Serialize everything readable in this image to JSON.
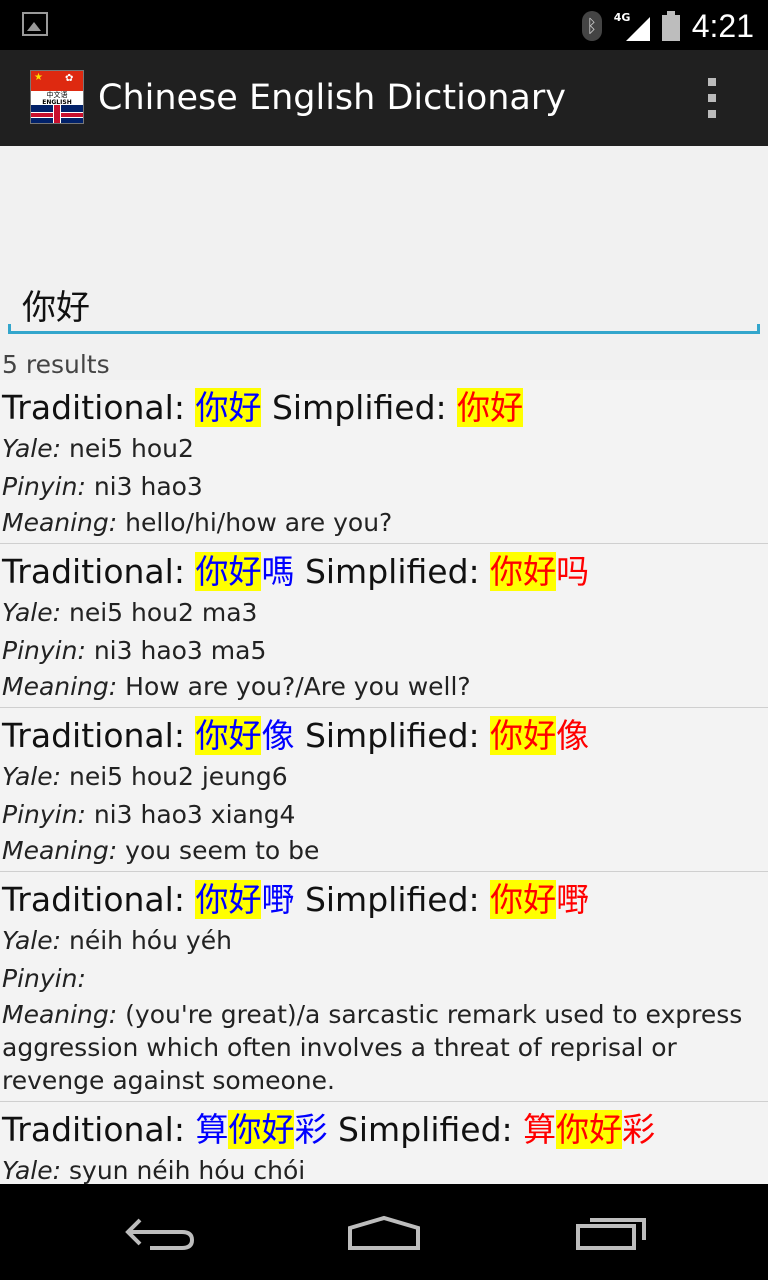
{
  "status_bar": {
    "time": "4:21",
    "network": "4G",
    "icons": [
      "image-notification-icon",
      "bluetooth-icon",
      "signal-icon",
      "battery-icon"
    ]
  },
  "app_bar": {
    "title": "Chinese English Dictionary",
    "logo_text_line1": "中文语",
    "logo_text_line2": "ENGLISH"
  },
  "search": {
    "value": "你好",
    "placeholder": ""
  },
  "results_count": "5 results",
  "labels": {
    "traditional": "Traditional:",
    "simplified": "Simplified:",
    "yale": "Yale:",
    "pinyin": "Pinyin:",
    "meaning": "Meaning:"
  },
  "entries": [
    {
      "trad": {
        "pre": "",
        "hl": "你好",
        "post": ""
      },
      "simp": {
        "pre": "",
        "hl": "你好",
        "post": ""
      },
      "yale": "nei5 hou2",
      "pinyin": "ni3 hao3",
      "meaning": "hello/hi/how are you?"
    },
    {
      "trad": {
        "pre": "",
        "hl": "你好",
        "post": "嗎"
      },
      "simp": {
        "pre": "",
        "hl": "你好",
        "post": "吗"
      },
      "yale": "nei5 hou2 ma3",
      "pinyin": "ni3 hao3 ma5",
      "meaning": "How are you?/Are you well?"
    },
    {
      "trad": {
        "pre": "",
        "hl": "你好",
        "post": "像"
      },
      "simp": {
        "pre": "",
        "hl": "你好",
        "post": "像"
      },
      "yale": "nei5 hou2 jeung6",
      "pinyin": "ni3 hao3 xiang4",
      "meaning": "you seem to be"
    },
    {
      "trad": {
        "pre": "",
        "hl": "你好",
        "post": "嘢"
      },
      "simp": {
        "pre": "",
        "hl": "你好",
        "post": "嘢"
      },
      "yale": "néih hóu yéh",
      "pinyin": "",
      "meaning": "(you're great)/a sarcastic remark used to express aggression which often involves a threat of reprisal or revenge against someone."
    },
    {
      "trad": {
        "pre": "算",
        "hl": "你好",
        "post": "彩"
      },
      "simp": {
        "pre": "算",
        "hl": "你好",
        "post": "彩"
      },
      "yale": "syun néih hóu chói",
      "pinyin": "",
      "meaning": ""
    }
  ],
  "nav": {
    "back": "back-icon",
    "home": "home-icon",
    "recents": "recents-icon"
  },
  "colors": {
    "traditional": "#0000ff",
    "simplified": "#ff0000",
    "highlight": "#ffff00",
    "accent": "#33a6cc",
    "app_bar": "#202020"
  }
}
